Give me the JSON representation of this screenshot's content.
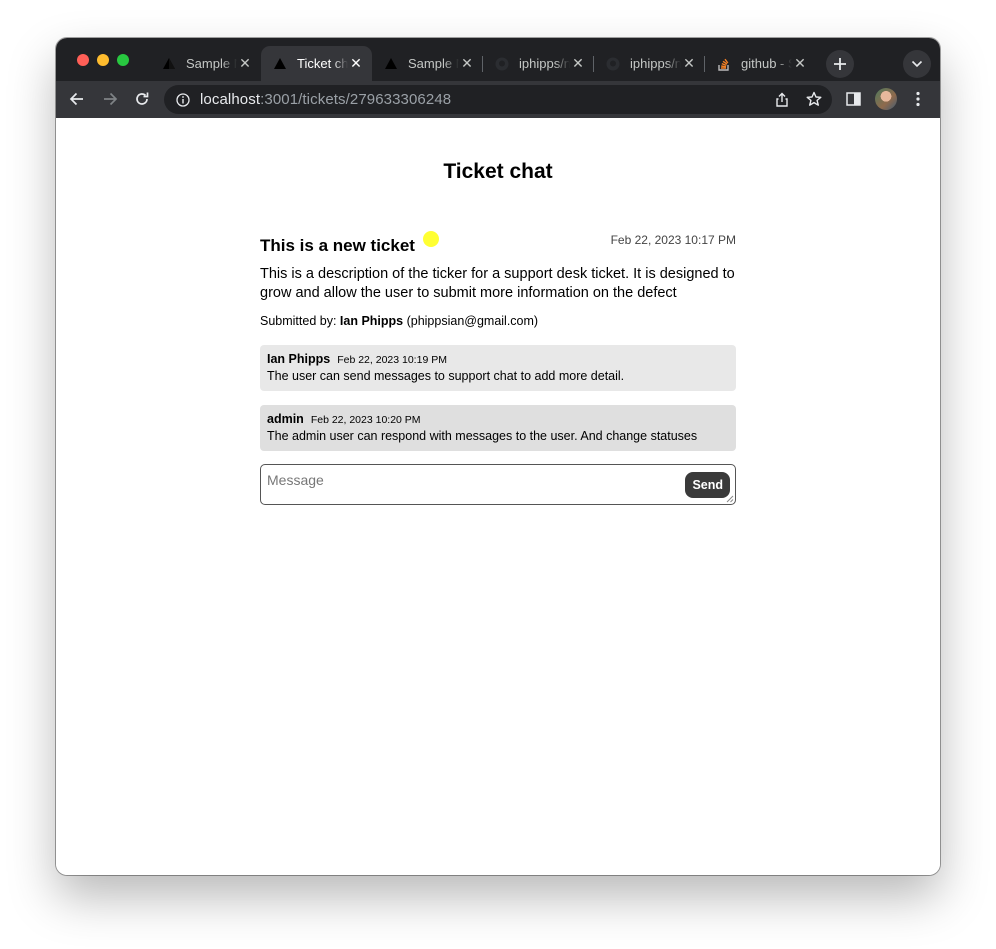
{
  "browser": {
    "tabs": [
      {
        "title": "Sample Next.js Ticketing App",
        "favicon": "vercel-triangle-icon",
        "active": false
      },
      {
        "title": "Ticket chat",
        "favicon": "vercel-triangle-icon",
        "active": true
      },
      {
        "title": "Sample Next.js Ticketing App",
        "favicon": "vercel-triangle-icon",
        "active": false
      },
      {
        "title": "iphipps/nextjs-ticketing",
        "favicon": "github-icon",
        "active": false
      },
      {
        "title": "iphipps/nextjs-ticketing",
        "favicon": "github-icon",
        "active": false
      },
      {
        "title": "github - Stack Overflow",
        "favicon": "stackoverflow-icon",
        "active": false
      }
    ],
    "address": {
      "host": "localhost",
      "path": ":3001/tickets/279633306248"
    },
    "colors": {
      "tabstrip": "#202124",
      "toolbar": "#35363a"
    }
  },
  "page": {
    "title": "Ticket chat",
    "ticket": {
      "title": "This is a new ticket",
      "status_color": "#ffff33",
      "date": "Feb 22, 2023 10:17 PM",
      "description": "This is a description of the ticker for a support desk ticket. It is designed to grow and allow the user to submit more information on the defect",
      "submitted_label": "Submitted by: ",
      "submitter_name": "Ian Phipps",
      "submitter_email": "(phippsian@gmail.com)"
    },
    "messages": [
      {
        "author": "Ian Phipps",
        "date": "Feb 22, 2023 10:19 PM",
        "text": "The user can send messages to support chat to add more detail."
      },
      {
        "author": "admin",
        "date": "Feb 22, 2023 10:20 PM",
        "text": "The admin user can respond with messages to the user. And change statuses"
      }
    ],
    "compose": {
      "placeholder": "Message",
      "send_label": "Send"
    }
  }
}
